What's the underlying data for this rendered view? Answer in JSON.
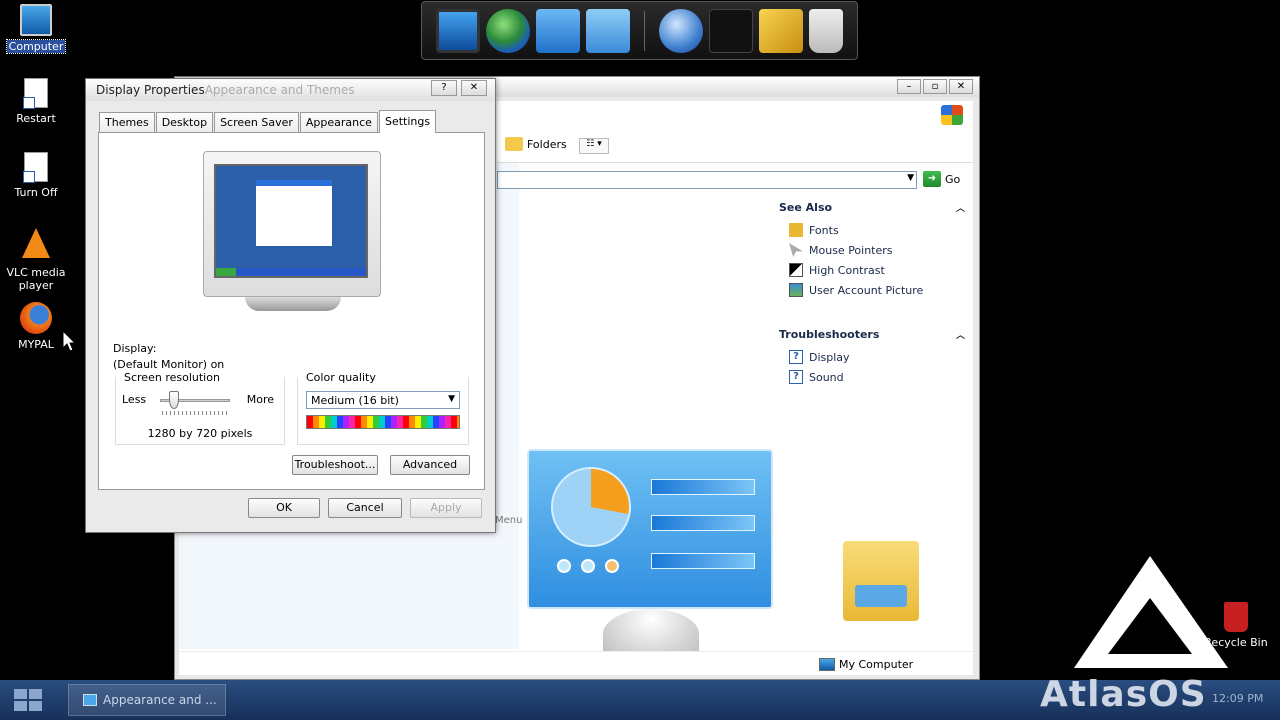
{
  "desktop_icons": [
    {
      "label": "Computer"
    },
    {
      "label": "Restart"
    },
    {
      "label": "Turn Off"
    },
    {
      "label": "VLC media player"
    },
    {
      "label": "MYPAL"
    }
  ],
  "dock": {
    "items": [
      "monitor-icon",
      "globe-network-icon",
      "documents-icon",
      "chart-icon",
      "internet-globe-icon",
      "tshirt-icon",
      "tools-icon",
      "recycle-bin-icon"
    ]
  },
  "explorer": {
    "title": "Appearance and Themes",
    "toolbar": {
      "folders_label": "Folders",
      "views_glyph": "☷ ▾"
    },
    "address_go_label": "Go",
    "see_also": {
      "title": "See Also",
      "links": [
        "Fonts",
        "Mouse Pointers",
        "High Contrast",
        "User Account Picture"
      ]
    },
    "troubleshooters": {
      "title": "Troubleshooters",
      "links": [
        "Display",
        "Sound"
      ]
    },
    "status_location": "My Computer",
    "partial_text": "Menu"
  },
  "dialog": {
    "title": "Display Properties",
    "ghost_title": "Appearance and Themes",
    "help_glyph": "?",
    "close_glyph": "✕",
    "tabs": [
      "Themes",
      "Desktop",
      "Screen Saver",
      "Appearance",
      "Settings"
    ],
    "active_tab": "Settings",
    "display_label": "Display:",
    "display_value": "(Default Monitor) on",
    "screen_resolution": {
      "legend": "Screen resolution",
      "less": "Less",
      "more": "More",
      "value": "1280 by 720 pixels",
      "slider_position": 0.2
    },
    "color_quality": {
      "legend": "Color quality",
      "selected": "Medium (16 bit)"
    },
    "buttons": {
      "troubleshoot": "Troubleshoot...",
      "advanced": "Advanced",
      "ok": "OK",
      "cancel": "Cancel",
      "apply": "Apply"
    }
  },
  "taskbar": {
    "task_label": "Appearance and ...",
    "clock": "12:09 PM",
    "brand": "AtlasOS"
  },
  "recycle_bin": {
    "label": "Recycle Bin"
  },
  "colors": {
    "taskbar": "#1d3a66",
    "dialog_bg": "#eaeaea",
    "link": "#1a2a4a"
  }
}
